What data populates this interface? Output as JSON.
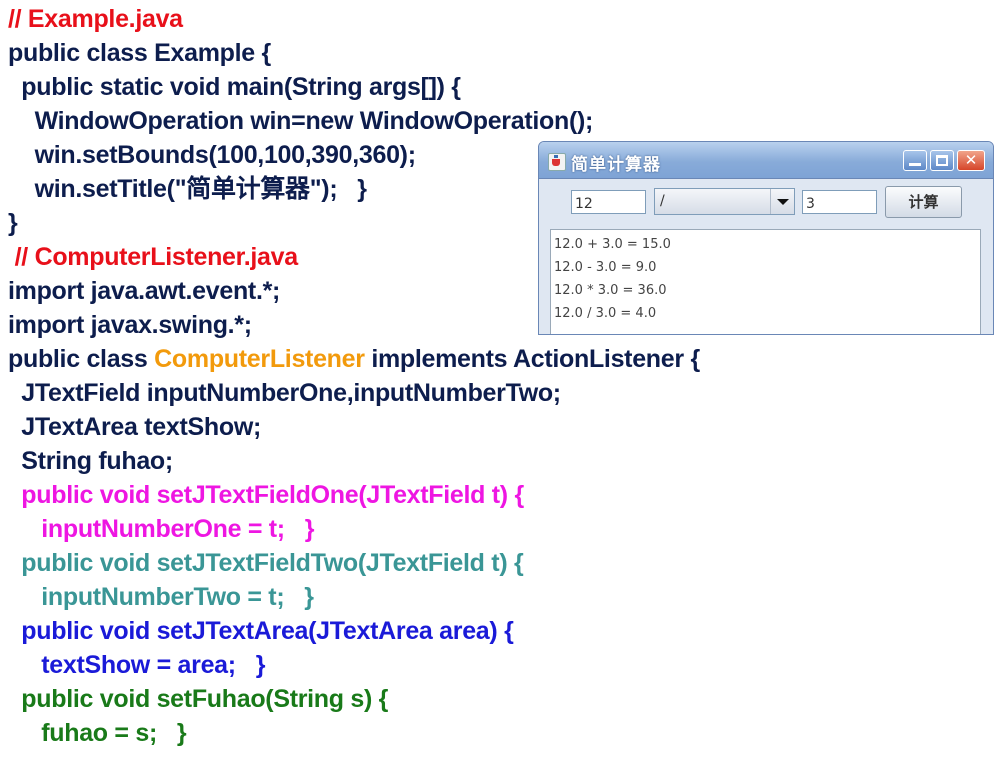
{
  "code": {
    "example_comment": "// Example.java",
    "ex_class_decl": "public class Example {",
    "ex_main": "  public static void main(String args[]) {",
    "ex_new_window": "    WindowOperation win=new WindowOperation();",
    "ex_setbounds": "    win.setBounds(100,100,390,360);",
    "ex_settitle": "    win.setTitle(\"简单计算器\");   }",
    "ex_close": "}",
    "listener_comment": " // ComputerListener.java",
    "import_awt": "import java.awt.event.*;",
    "import_swing": "import javax.swing.*;",
    "cl_decl_pre": "public class ",
    "cl_decl_name": "ComputerListener",
    "cl_decl_post": " implements ActionListener {",
    "field_textfields": "  JTextField inputNumberOne,inputNumberTwo;",
    "field_textarea": "  JTextArea textShow;",
    "field_fuhao": "  String fuhao;",
    "m1_sig": "  public void setJTextFieldOne(JTextField t) {",
    "m1_body": "     inputNumberOne = t;   }",
    "m2_sig": "  public void setJTextFieldTwo(JTextField t) {",
    "m2_body": "     inputNumberTwo = t;   }",
    "m3_sig": "  public void setJTextArea(JTextArea area) {",
    "m3_body": "     textShow = area;   }",
    "m4_sig": "  public void setFuhao(String s) {",
    "m4_body": "     fuhao = s;   }"
  },
  "window": {
    "title": "简单计算器",
    "minimize_icon": "minimize-icon",
    "maximize_icon": "maximize-icon",
    "close_icon": "close-icon",
    "close_glyph": "✕",
    "input_one_value": "12",
    "operator_selected": "/",
    "input_two_value": "3",
    "calc_button_label": "计算",
    "results": [
      "12.0 + 3.0 = 15.0",
      "12.0 - 3.0 = 9.0",
      "12.0 * 3.0 = 36.0",
      "12.0 / 3.0 = 4.0"
    ]
  },
  "colors": {
    "code_default": "#0d1d4d",
    "comment": "#e8101a",
    "class_name": "#f29a0c",
    "method1": "#ee16e2",
    "method2": "#3a9696",
    "method3": "#1a1ad8",
    "method4": "#197a19"
  }
}
